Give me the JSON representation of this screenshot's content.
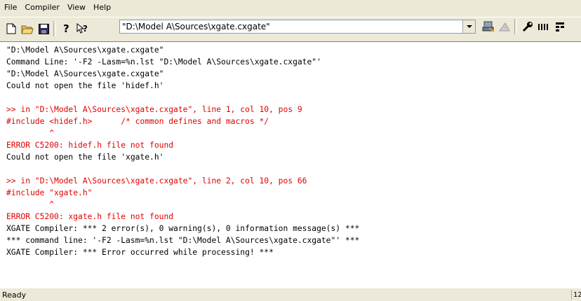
{
  "menu": {
    "items": [
      "File",
      "Compiler",
      "View",
      "Help"
    ]
  },
  "toolbar": {
    "icons": [
      "new-file-icon",
      "open-folder-icon",
      "save-icon",
      "help-icon",
      "context-help-icon",
      "compile-icon",
      "cancel-compile-icon",
      "options-icon",
      "messages-icon",
      "grid-icon"
    ],
    "source_file": "\"D:\\Model A\\Sources\\xgate.cxgate\""
  },
  "output": {
    "lines": [
      {
        "text": "\"D:\\Model A\\Sources\\xgate.cxgate\"",
        "color": "#000000"
      },
      {
        "text": "Command Line: '-F2 -Lasm=%n.lst \"D:\\Model A\\Sources\\xgate.cxgate\"'",
        "color": "#000000"
      },
      {
        "text": "\"D:\\Model A\\Sources\\xgate.cxgate\"",
        "color": "#000000"
      },
      {
        "text": "Could not open the file 'hidef.h'",
        "color": "#000000"
      },
      {
        "text": "",
        "color": "#000000"
      },
      {
        "text": ">> in \"D:\\Model A\\Sources\\xgate.cxgate\", line 1, col 10, pos 9",
        "color": "#e00000"
      },
      {
        "text": "#include <hidef.h>      /* common defines and macros */",
        "color": "#e00000"
      },
      {
        "text": "         ^",
        "color": "#e00000"
      },
      {
        "text": "ERROR C5200: hidef.h file not found",
        "color": "#e00000"
      },
      {
        "text": "Could not open the file 'xgate.h'",
        "color": "#000000"
      },
      {
        "text": "",
        "color": "#000000"
      },
      {
        "text": ">> in \"D:\\Model A\\Sources\\xgate.cxgate\", line 2, col 10, pos 66",
        "color": "#e00000"
      },
      {
        "text": "#include \"xgate.h\"",
        "color": "#e00000"
      },
      {
        "text": "         ^",
        "color": "#e00000"
      },
      {
        "text": "ERROR C5200: xgate.h file not found",
        "color": "#e00000"
      },
      {
        "text": "XGATE Compiler: *** 2 error(s), 0 warning(s), 0 information message(s) ***",
        "color": "#000000"
      },
      {
        "text": "*** command line: '-F2 -Lasm=%n.lst \"D:\\Model A\\Sources\\xgate.cxgate\"' ***",
        "color": "#000000"
      },
      {
        "text": "XGATE Compiler: *** Error occurred while processing! ***",
        "color": "#000000"
      }
    ]
  },
  "status": {
    "text": "Ready",
    "panel": "12"
  }
}
